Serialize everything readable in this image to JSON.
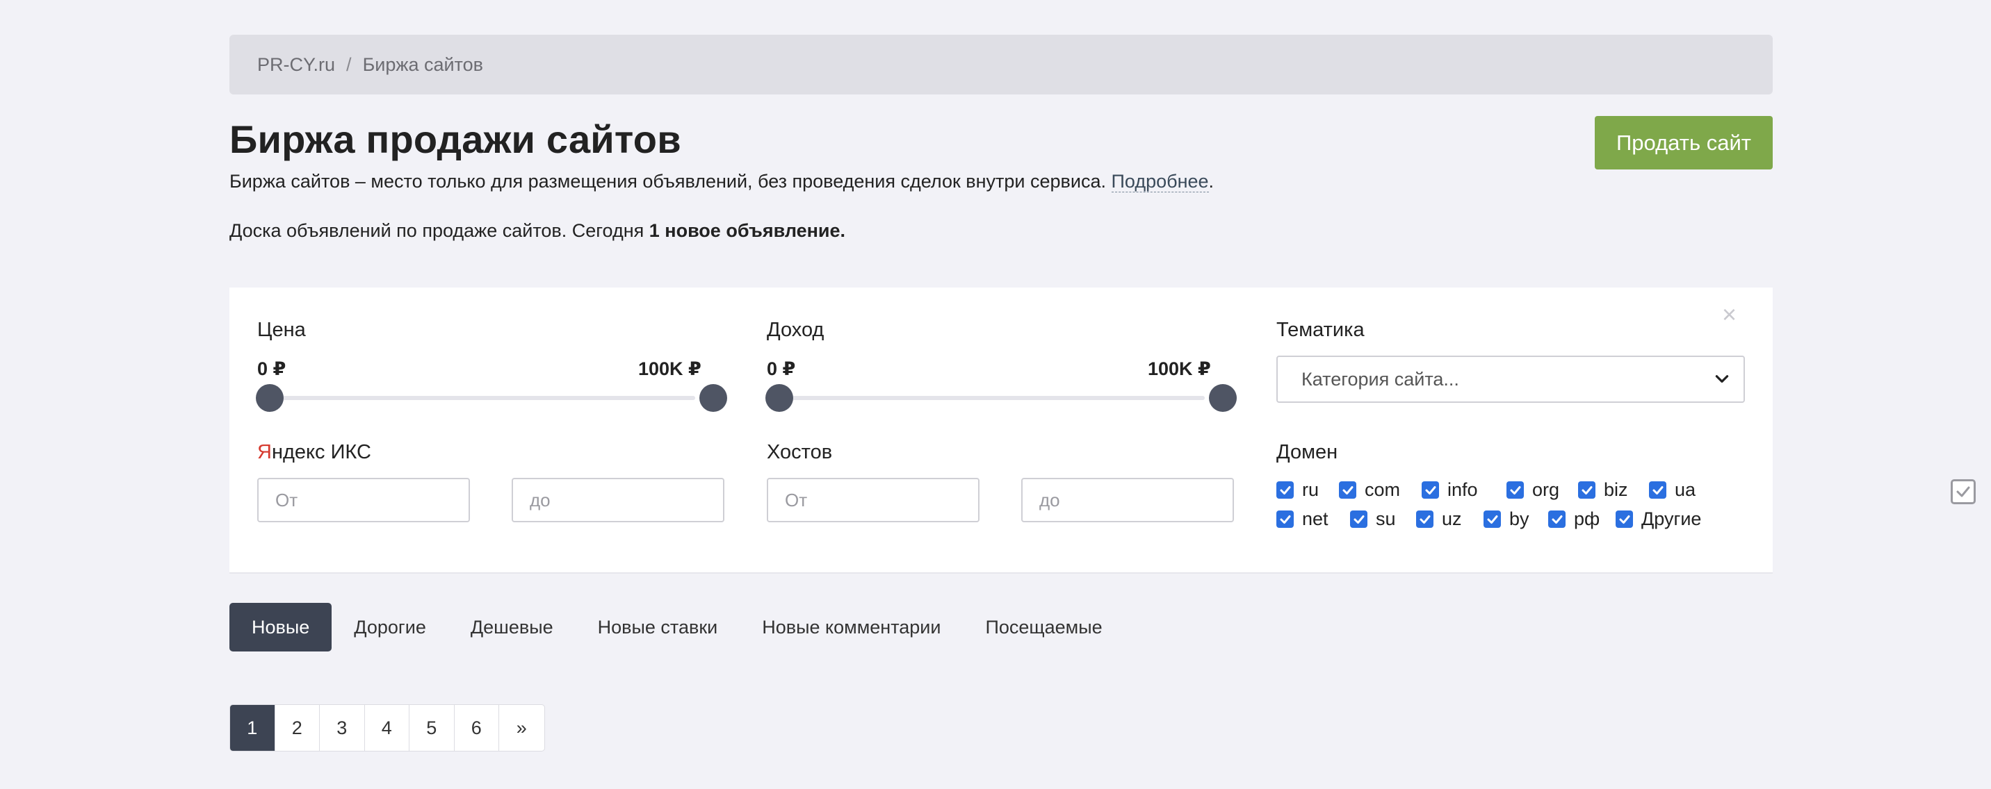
{
  "breadcrumb": {
    "home": "PR-CY.ru",
    "separator": "/",
    "current": "Биржа сайтов"
  },
  "header": {
    "title": "Биржа продажи сайтов",
    "sell_button": "Продать сайт",
    "description": "Биржа сайтов – место только для размещения объявлений, без проведения сделок внутри сервиса.",
    "more_link": "Подробнее",
    "more_suffix": ".",
    "board_text": "Доска объявлений по продаже сайтов. Сегодня",
    "board_bold": "1 новое объявление."
  },
  "filters": {
    "close": "×",
    "price": {
      "label": "Цена",
      "min_label": "0 ₽",
      "max_label": "100K ₽",
      "min_fraction": 0.0,
      "max_fraction": 1.0
    },
    "income": {
      "label": "Доход",
      "min_label": "0 ₽",
      "max_label": "100K ₽",
      "min_fraction": 0.0,
      "max_fraction": 1.0
    },
    "topic": {
      "label": "Тематика",
      "select_value": "Категория сайта..."
    },
    "yandex": {
      "label_first": "Я",
      "label_rest": "ндекс ИКС",
      "from_placeholder": "От",
      "to_placeholder": "до"
    },
    "hosts": {
      "label": "Хостов",
      "from_placeholder": "От",
      "to_placeholder": "до"
    },
    "domain": {
      "label": "Домен",
      "row1": [
        "ru",
        "com",
        "info",
        "org",
        "biz",
        "ua"
      ],
      "row2": [
        "net",
        "su",
        "uz",
        "by",
        "рф",
        "Другие"
      ]
    }
  },
  "tabs": [
    "Новые",
    "Дорогие",
    "Дешевые",
    "Новые ставки",
    "Новые комментарии",
    "Посещаемые"
  ],
  "pagination": [
    "1",
    "2",
    "3",
    "4",
    "5",
    "6",
    "»"
  ],
  "colors": {
    "accent_green": "#7fa84a",
    "dark_active": "#3d4453",
    "checkbox_blue": "#2b6fe0"
  }
}
